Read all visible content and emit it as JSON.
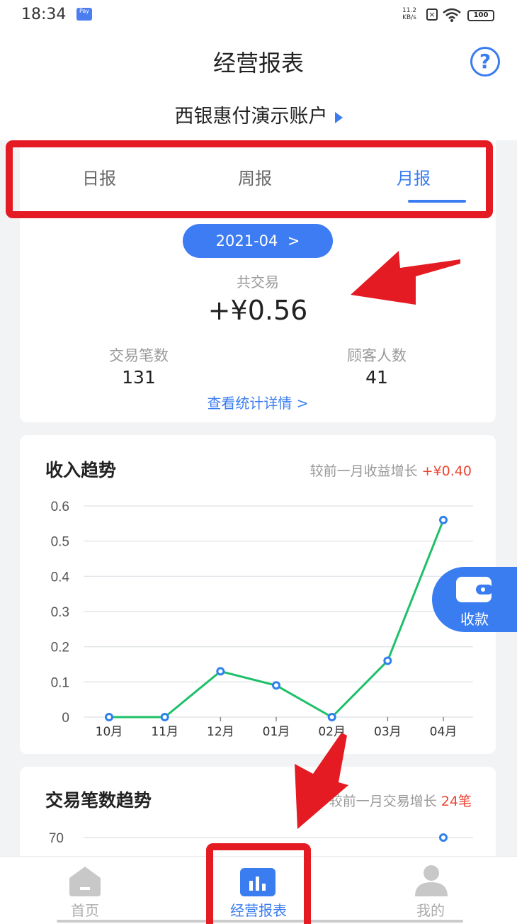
{
  "status_bar": {
    "time": "18:34",
    "pay_badge": "Pay",
    "net_speed_value": "11.2",
    "net_speed_unit": "KB/s",
    "battery": "100"
  },
  "header": {
    "title": "经营报表",
    "help_symbol": "?",
    "account_name": "西银惠付演示账户"
  },
  "tabs": [
    {
      "label": "日报",
      "active": false
    },
    {
      "label": "周报",
      "active": false
    },
    {
      "label": "月报",
      "active": true
    }
  ],
  "summary": {
    "month": "2021-04",
    "month_chevron": ">",
    "total_label": "共交易",
    "total_value": "+¥0.56",
    "transactions_label": "交易笔数",
    "transactions_value": "131",
    "customers_label": "顾客人数",
    "customers_value": "41",
    "details_link": "查看统计详情 >"
  },
  "income_card": {
    "title": "收入趋势",
    "compare_label": "较前一月收益增长",
    "compare_value": "+¥0.40"
  },
  "transactions_card": {
    "title": "交易笔数趋势",
    "compare_label": "较前一月交易增长",
    "compare_value": "24笔"
  },
  "fab": {
    "label": "收款"
  },
  "bottom_nav": [
    {
      "label": "首页",
      "active": false
    },
    {
      "label": "经营报表",
      "active": true
    },
    {
      "label": "我的",
      "active": false
    }
  ],
  "colors": {
    "accent": "#3a7df0",
    "line": "#1ec06a",
    "point": "#2f80ed",
    "highlight": "#ee4433",
    "annotation": "#e41b23"
  },
  "chart_data": [
    {
      "type": "line",
      "title": "收入趋势",
      "categories": [
        "10月",
        "11月",
        "12月",
        "01月",
        "02月",
        "03月",
        "04月"
      ],
      "values": [
        0,
        0,
        0.13,
        0.09,
        0,
        0.16,
        0.56
      ],
      "yticks": [
        "0",
        "0.1",
        "0.2",
        "0.3",
        "0.4",
        "0.5",
        "0.6"
      ],
      "ylim": [
        0,
        0.6
      ],
      "grid": true
    },
    {
      "type": "line",
      "title": "交易笔数趋势",
      "yticks": [
        "70"
      ],
      "visible_points": [
        {
          "category": "04月",
          "value": 70
        }
      ],
      "grid": true
    }
  ]
}
